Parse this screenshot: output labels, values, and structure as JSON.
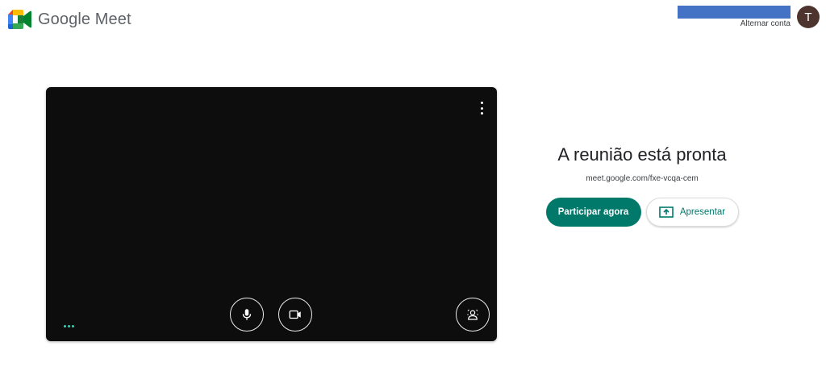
{
  "header": {
    "app_name": "Google Meet",
    "logo_icon": "google-meet-logo",
    "switch_account_label": "Alternar conta",
    "avatar_initial": "T",
    "avatar_color": "#4e342e",
    "redaction_color": "#4472c4"
  },
  "preview": {
    "menu_icon": "more-vert-icon",
    "mic_icon": "microphone-icon",
    "camera_icon": "video-camera-icon",
    "effects_icon": "visual-effects-icon",
    "audio_indicator_color": "#34d3b2"
  },
  "ready": {
    "title": "A reunião está pronta",
    "url": "meet.google.com/fxe-vcqa-cem",
    "join_label": "Participar agora",
    "present_label": "Apresentar",
    "present_icon": "present-screen-icon",
    "accent_color": "#00796b"
  }
}
